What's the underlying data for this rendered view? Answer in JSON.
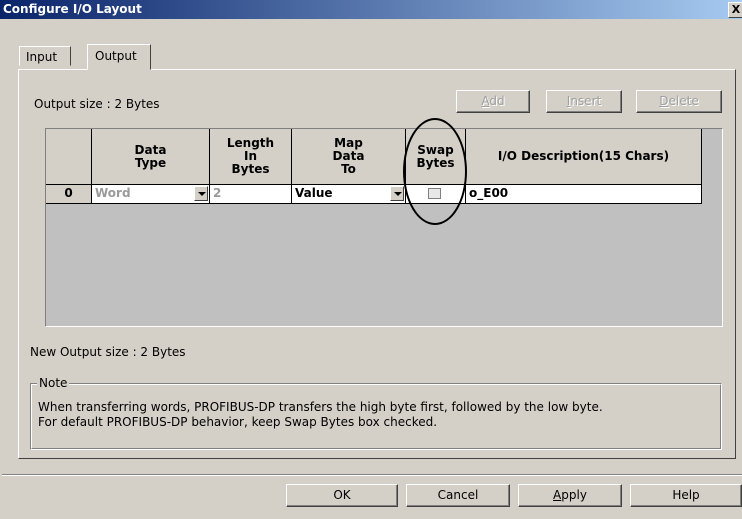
{
  "window": {
    "title": "Configure I/O Layout",
    "close_label": "X"
  },
  "tabs": [
    {
      "label": "Input",
      "selected": false
    },
    {
      "label": "Output",
      "selected": true
    }
  ],
  "output_size_label": "Output size : 2 Bytes",
  "toolbar": {
    "add": {
      "pre": "",
      "u": "A",
      "post": "dd",
      "enabled": false
    },
    "insert": {
      "pre": "",
      "u": "I",
      "post": "nsert",
      "enabled": false
    },
    "delete": {
      "pre": "",
      "u": "D",
      "post": "elete",
      "enabled": false
    }
  },
  "table": {
    "headers": {
      "data_type": "Data\nType",
      "length": "Length\nIn\nBytes",
      "map": "Map\nData\nTo",
      "swap": "Swap\nBytes",
      "desc": "I/O Description(15 Chars)"
    },
    "rows": [
      {
        "index": "0",
        "data_type": "Word",
        "length": "2",
        "map": "Value",
        "swap_checked": false,
        "desc": "o_E00"
      }
    ]
  },
  "new_output_size_label": "New Output size : 2 Bytes",
  "note": {
    "legend": "Note",
    "line1": "When transferring words, PROFIBUS-DP transfers the high byte first, followed by the low byte.",
    "line2": "For default PROFIBUS-DP behavior, keep Swap Bytes box checked."
  },
  "footer": {
    "ok": {
      "pre": "OK",
      "u": "",
      "post": ""
    },
    "cancel": {
      "pre": "Cancel",
      "u": "",
      "post": ""
    },
    "apply": {
      "pre": "",
      "u": "A",
      "post": "pply"
    },
    "help": {
      "pre": "Help",
      "u": "",
      "post": ""
    }
  },
  "colors": {
    "title_start": "#0a246a",
    "title_end": "#a6caf0",
    "dialog_bg": "#d4d0c8",
    "grid_bg": "#c0c0c0"
  }
}
